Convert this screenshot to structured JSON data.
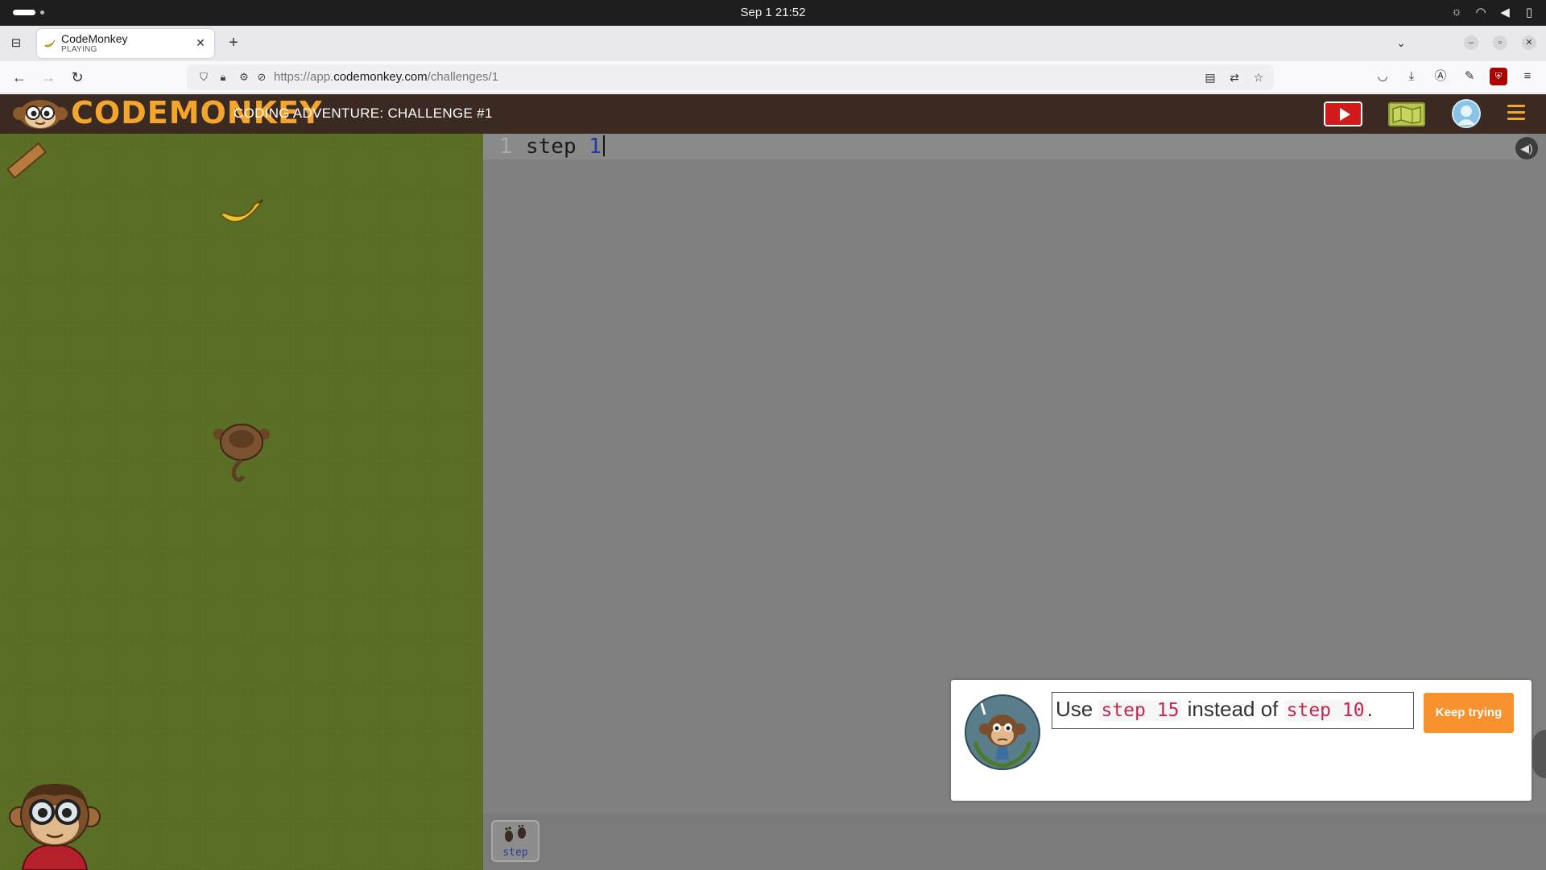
{
  "os": {
    "clock": "Sep 1  21:52",
    "tray_icons": [
      "brightness-icon",
      "wifi-icon",
      "volume-icon",
      "battery-icon"
    ]
  },
  "browser": {
    "tab": {
      "title": "CodeMonkey",
      "subtitle": "PLAYING",
      "favicon": "banana-icon"
    },
    "url_prefix": "https://app.",
    "url_domain": "codemonkey.com",
    "url_path": "/challenges/1"
  },
  "app": {
    "logo_text": "CODEMONKEY",
    "challenge_title": "CODING ADVENTURE: CHALLENGE #1",
    "colors": {
      "header_bg": "#3b2a21",
      "logo_accent": "#f3a52c",
      "run_button": "#d11a1a",
      "grass": "#5a6e26",
      "editor_bg": "#808080",
      "keep_trying": "#f7922e"
    }
  },
  "editor": {
    "line_number": "1",
    "code_keyword": "step",
    "code_value": "1"
  },
  "toolbar": {
    "step_label": "step"
  },
  "hint": {
    "prefix": "Use",
    "code_a": "step 15",
    "middle": "instead of",
    "code_b": "step 10",
    "suffix": ".",
    "button_label": "Keep trying"
  }
}
